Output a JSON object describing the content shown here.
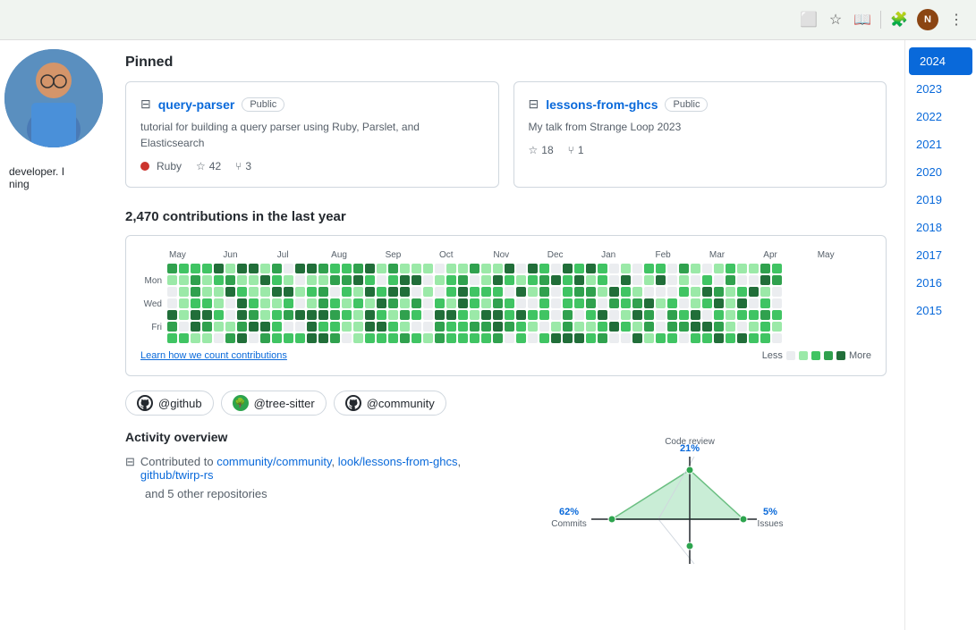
{
  "browser": {
    "avatar_initial": "N",
    "avatar_bg": "#8b4513"
  },
  "pinned": {
    "title": "Pinned",
    "cards": [
      {
        "id": "query-parser",
        "name": "query-parser",
        "visibility": "Public",
        "description": "tutorial for building a query parser using Ruby, Parslet, and Elasticsearch",
        "language": "Ruby",
        "lang_color": "#cc342d",
        "stars": "42",
        "forks": "3"
      },
      {
        "id": "lessons-from-ghcs",
        "name": "lessons-from-ghcs",
        "visibility": "Public",
        "description": "My talk from Strange Loop 2023",
        "language": "",
        "lang_color": "",
        "stars": "18",
        "forks": "1"
      }
    ]
  },
  "contributions": {
    "summary": "2,470 contributions in the last year",
    "months": [
      "May",
      "Jun",
      "Jul",
      "Aug",
      "Sep",
      "Oct",
      "Nov",
      "Dec",
      "Jan",
      "Feb",
      "Mar",
      "Apr",
      "May"
    ],
    "day_labels": [
      "Mon",
      "",
      "Wed",
      "",
      "Fri"
    ],
    "learn_link": "Learn how we count contributions",
    "less_label": "Less",
    "more_label": "More"
  },
  "years": [
    "2024",
    "2023",
    "2022",
    "2021",
    "2020",
    "2019",
    "2018",
    "2017",
    "2016",
    "2015"
  ],
  "active_year": "2024",
  "orgs": [
    {
      "id": "github",
      "name": "@github",
      "type": "github"
    },
    {
      "id": "tree-sitter",
      "name": "@tree-sitter",
      "type": "tree"
    },
    {
      "id": "community",
      "name": "@community",
      "type": "community"
    }
  ],
  "activity": {
    "title": "Activity overview",
    "contributed_label": "Contributed to",
    "repos": [
      {
        "name": "community/community",
        "url": "#"
      },
      {
        "name": "look/lessons-from-ghcs",
        "url": "#"
      },
      {
        "name": "github/twirp-rs",
        "url": "#"
      }
    ],
    "other": "and 5 other repositories"
  },
  "radar": {
    "commits_pct": "62%",
    "commits_label": "Commits",
    "code_review_pct": "21%",
    "code_review_label": "Code review",
    "issues_pct": "5%",
    "issues_label": "Issues"
  },
  "sidebar": {
    "description_line1": "developer. I",
    "description_line2": "ning"
  }
}
